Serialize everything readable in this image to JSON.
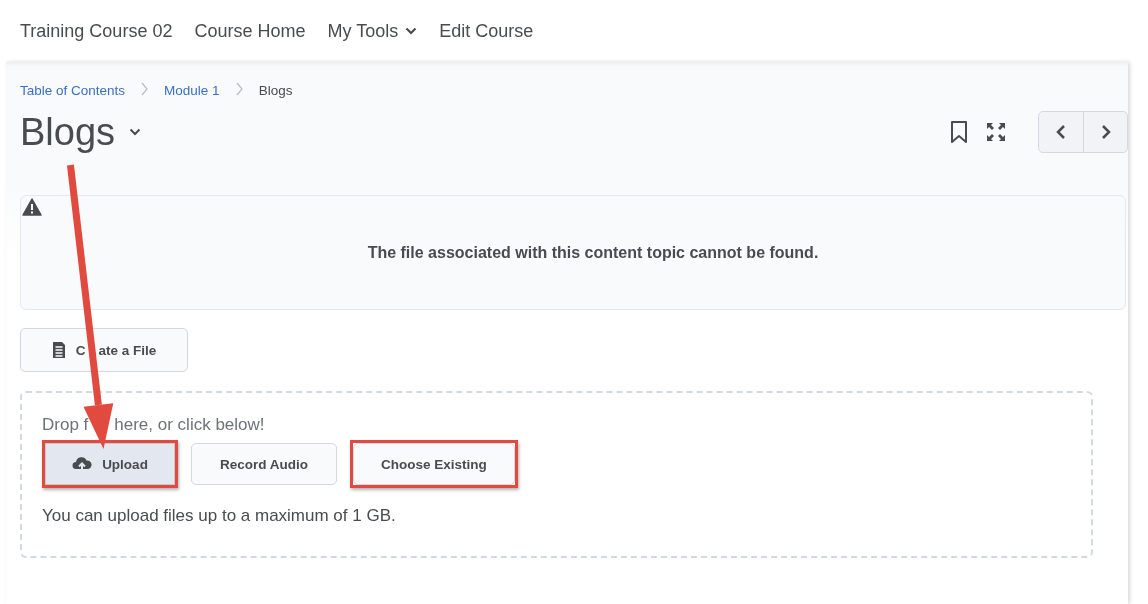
{
  "nav": [
    {
      "label": "Training Course 02",
      "kind": "link"
    },
    {
      "label": "Course Home",
      "kind": "link"
    },
    {
      "label": "My Tools",
      "kind": "menu"
    },
    {
      "label": "Edit Course",
      "kind": "link"
    }
  ],
  "breadcrumbs": [
    {
      "label": "Table of Contents",
      "kind": "link"
    },
    {
      "label": "Module 1",
      "kind": "link"
    },
    {
      "label": "Blogs",
      "kind": "current"
    }
  ],
  "title": "Blogs",
  "alert": {
    "message": "The file associated with this content topic cannot be found."
  },
  "create_button": {
    "label_parts": [
      "C",
      "ate a File"
    ]
  },
  "dropzone": {
    "prompt_parts": [
      "Drop f",
      "here, or click below!"
    ],
    "buttons": [
      {
        "label": "Upload",
        "kind": "upload",
        "pressed": true,
        "highlighted": true
      },
      {
        "label": "Record Audio",
        "kind": "plain",
        "pressed": false,
        "highlighted": false
      },
      {
        "label": "Choose Existing",
        "kind": "plain",
        "pressed": false,
        "highlighted": true
      }
    ],
    "note": "You can upload files up to a maximum of 1 GB."
  }
}
